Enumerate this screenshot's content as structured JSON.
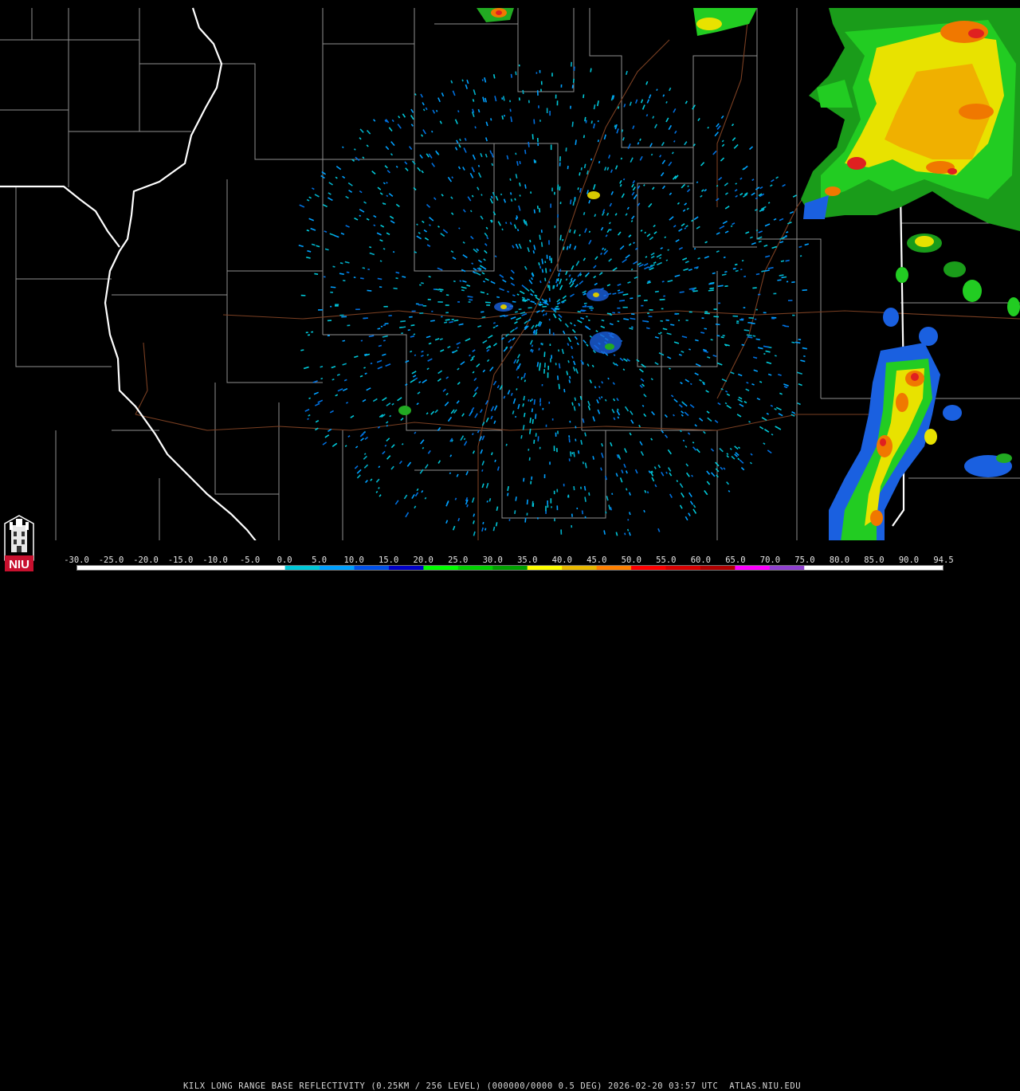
{
  "product": {
    "caption": "KILX LONG RANGE BASE REFLECTIVITY (0.25KM / 256 LEVEL) (000000/0000 0.5 DEG) 2026-02-20 03:57 UTC  ATLAS.NIU.EDU"
  },
  "colorbar": {
    "ticks": [
      "-30.0",
      "-25.0",
      "-20.0",
      "-15.0",
      "-10.0",
      "-5.0",
      "0.0",
      "5.0",
      "10.0",
      "15.0",
      "20.0",
      "25.0",
      "30.0",
      "35.0",
      "40.0",
      "45.0",
      "50.0",
      "55.0",
      "60.0",
      "65.0",
      "70.0",
      "75.0",
      "80.0",
      "85.0",
      "90.0",
      "94.5"
    ],
    "colors": [
      "#ffffff",
      "#ffffff",
      "#ffffff",
      "#ffffff",
      "#ffffff",
      "#ffffff",
      "#00c8d8",
      "#00a0ff",
      "#0050e8",
      "#0000c8",
      "#00ff00",
      "#00d000",
      "#00a000",
      "#ffff00",
      "#e8b800",
      "#ff8000",
      "#ff0000",
      "#d80000",
      "#b00000",
      "#ff00ff",
      "#9040d0",
      "#ffffff",
      "#ffffff",
      "#ffffff",
      "#ffffff"
    ]
  },
  "logo": {
    "text": "NIU",
    "brand_color": "#c8102e"
  },
  "colors": {
    "state_border": "#ffffff",
    "county_line": "#909090",
    "highway": "#8a4a2a",
    "background": "#000000"
  }
}
